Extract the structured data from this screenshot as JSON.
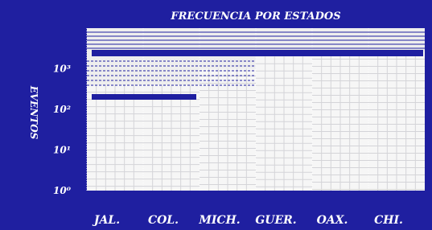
{
  "colors": {
    "background": "#1f1fa0",
    "plot_background": "#eeeeee",
    "bar_fill": "#f6f6f6",
    "grid_line": "#d4d4d8",
    "band_line": "#1f1fa0",
    "text": "#ffffff"
  },
  "chart_data": {
    "type": "bar",
    "title": "FRECUENCIA POR ESTADOS",
    "xlabel": "",
    "ylabel": "EVENTOS",
    "y_scale": "log",
    "yticks": [
      {
        "value": 1,
        "label": "10⁰"
      },
      {
        "value": 10,
        "label": "10¹"
      },
      {
        "value": 100,
        "label": "10²"
      },
      {
        "value": 1000,
        "label": "10³"
      }
    ],
    "ylim": [
      1,
      10000
    ],
    "categories": [
      "JAL.",
      "COL.",
      "MICH.",
      "GUER.",
      "OAX.",
      "CHI."
    ],
    "values": [
      400,
      400,
      1000,
      2000,
      2600,
      2600
    ],
    "grid": true,
    "legend": "none"
  }
}
